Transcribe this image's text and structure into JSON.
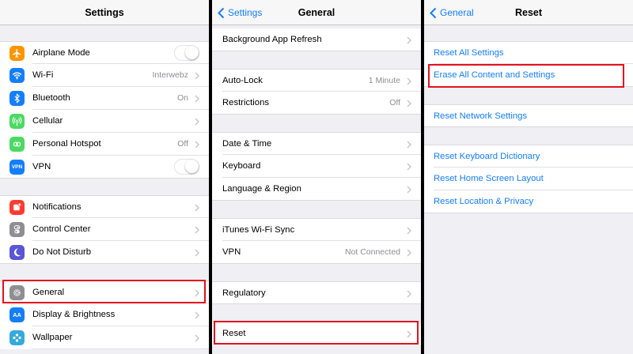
{
  "settings": {
    "title": "Settings",
    "items": [
      {
        "label": "Airplane Mode",
        "icon": "airplane-icon",
        "color": "#ff9500",
        "toggle": false
      },
      {
        "label": "Wi-Fi",
        "icon": "wifi-icon",
        "color": "#147efb",
        "value": "Interwebz"
      },
      {
        "label": "Bluetooth",
        "icon": "bluetooth-icon",
        "color": "#147efb",
        "value": "On"
      },
      {
        "label": "Cellular",
        "icon": "cellular-icon",
        "color": "#4cd964"
      },
      {
        "label": "Personal Hotspot",
        "icon": "hotspot-icon",
        "color": "#4cd964",
        "value": "Off"
      },
      {
        "label": "VPN",
        "icon": "vpn-icon",
        "color": "#147efb",
        "icon_text": "VPN",
        "toggle": false
      },
      {
        "label": "Notifications",
        "icon": "notifications-icon",
        "color": "#ff3b30"
      },
      {
        "label": "Control Center",
        "icon": "control-center-icon",
        "color": "#8e8e93"
      },
      {
        "label": "Do Not Disturb",
        "icon": "moon-icon",
        "color": "#5856d6"
      },
      {
        "label": "General",
        "icon": "gear-icon",
        "color": "#8e8e93",
        "highlighted": true
      },
      {
        "label": "Display & Brightness",
        "icon": "display-icon",
        "color": "#147efb",
        "icon_text": "AA"
      },
      {
        "label": "Wallpaper",
        "icon": "wallpaper-icon",
        "color": "#34aadc"
      }
    ]
  },
  "general": {
    "back_label": "Settings",
    "title": "General",
    "items": [
      {
        "label": "Background App Refresh"
      },
      {
        "label": "Auto-Lock",
        "value": "1 Minute"
      },
      {
        "label": "Restrictions",
        "value": "Off"
      },
      {
        "label": "Date & Time"
      },
      {
        "label": "Keyboard"
      },
      {
        "label": "Language & Region"
      },
      {
        "label": "iTunes Wi-Fi Sync"
      },
      {
        "label": "VPN",
        "value": "Not Connected"
      },
      {
        "label": "Regulatory"
      },
      {
        "label": "Reset",
        "highlighted": true
      }
    ]
  },
  "reset": {
    "back_label": "General",
    "title": "Reset",
    "items": [
      {
        "label": "Reset All Settings"
      },
      {
        "label": "Erase All Content and Settings",
        "highlighted": true
      },
      {
        "label": "Reset Network Settings"
      },
      {
        "label": "Reset Keyboard Dictionary"
      },
      {
        "label": "Reset Home Screen Layout"
      },
      {
        "label": "Reset Location & Privacy"
      }
    ]
  },
  "colors": {
    "accent": "#147efb",
    "highlight": "#e3101e",
    "background": "#efeff4"
  }
}
